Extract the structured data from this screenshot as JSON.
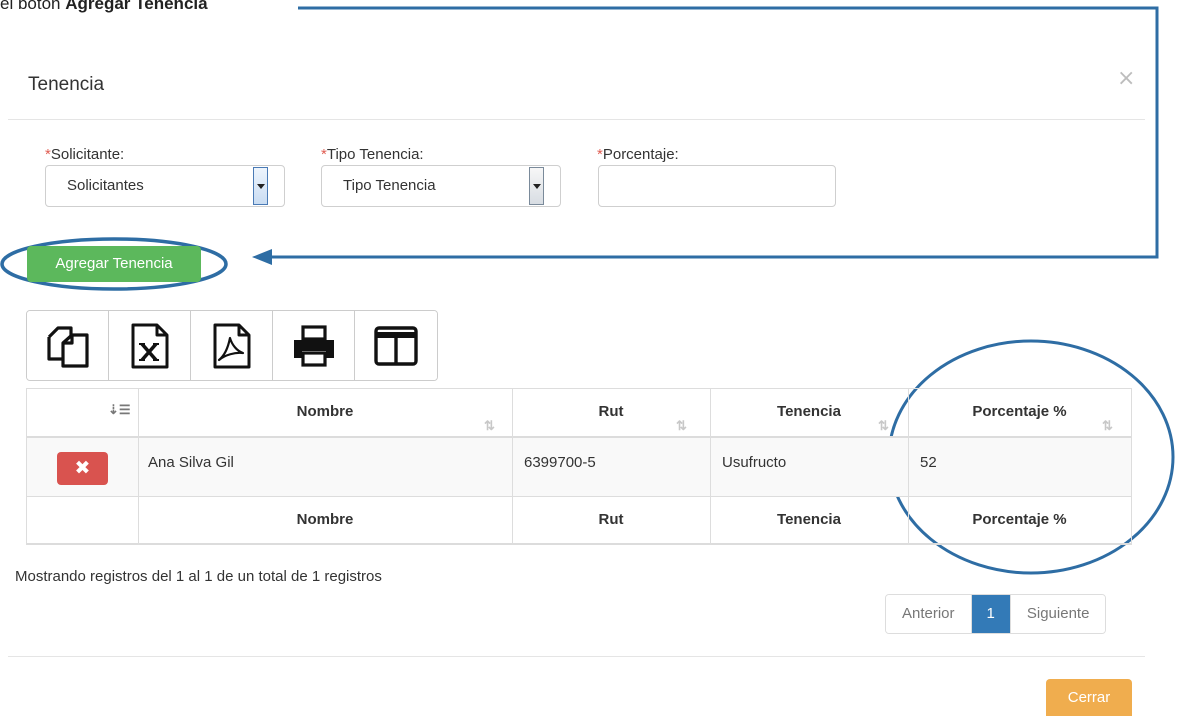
{
  "caption": {
    "prefix": "el botón ",
    "bold": "Agregar Tenencia"
  },
  "modal": {
    "title": "Tenencia",
    "close_label": "×"
  },
  "form": {
    "solicitante": {
      "required_mark": "*",
      "label": "Solicitante:",
      "value": "Solicitantes"
    },
    "tipo_tenencia": {
      "required_mark": "*",
      "label": "Tipo Tenencia:",
      "value": "Tipo Tenencia"
    },
    "porcentaje": {
      "required_mark": "*",
      "label": "Porcentaje:",
      "value": ""
    },
    "add_button": "Agregar Tenencia"
  },
  "toolbar": {
    "buttons": [
      {
        "name": "copy",
        "icon": "copy-icon"
      },
      {
        "name": "excel",
        "icon": "excel-file-icon"
      },
      {
        "name": "pdf",
        "icon": "pdf-file-icon"
      },
      {
        "name": "print",
        "icon": "printer-icon"
      },
      {
        "name": "columns",
        "icon": "columns-icon"
      }
    ]
  },
  "table": {
    "headers": [
      "",
      "Nombre",
      "Rut",
      "Tenencia",
      "Porcentaje %"
    ],
    "rows": [
      {
        "nombre": "Ana Silva Gil",
        "rut": "6399700-5",
        "tenencia": "Usufructo",
        "porcentaje": "52"
      }
    ],
    "footers": [
      "",
      "Nombre",
      "Rut",
      "Tenencia",
      "Porcentaje %"
    ]
  },
  "info": "Mostrando registros del 1 al 1 de un total de 1 registros",
  "pagination": {
    "prev": "Anterior",
    "current": "1",
    "next": "Siguiente"
  },
  "footer": {
    "close_button": "Cerrar"
  },
  "colors": {
    "annotation": "#2e6da4",
    "success": "#5cb85c",
    "danger": "#d9534f",
    "primary": "#337ab7",
    "warning": "#f0ad4e"
  }
}
